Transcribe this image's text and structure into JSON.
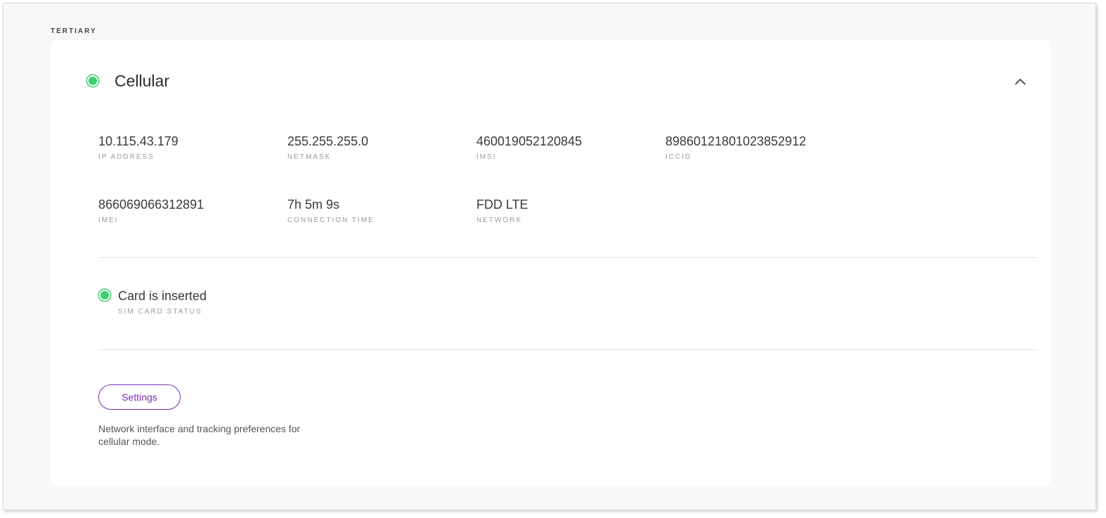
{
  "section": {
    "label": "TERTIARY"
  },
  "interface": {
    "title": "Cellular",
    "status_color": "#3ecf6e",
    "collapse_icon": "chevron-up-icon"
  },
  "fields": {
    "ip_address": {
      "value": "10.115.43.179",
      "label": "IP ADDRESS"
    },
    "netmask": {
      "value": "255.255.255.0",
      "label": "NETMASK"
    },
    "imsi": {
      "value": "460019052120845",
      "label": "IMSI"
    },
    "iccid": {
      "value": "89860121801023852912",
      "label": "ICCID"
    },
    "imei": {
      "value": "866069066312891",
      "label": "IMEI"
    },
    "connection_time": {
      "value": "7h 5m 9s",
      "label": "CONNECTION TIME"
    },
    "network": {
      "value": "FDD LTE",
      "label": "NETWORK"
    }
  },
  "sim": {
    "value": "Card is inserted",
    "label": "SIM CARD STATUS",
    "status_color": "#3ecf6e"
  },
  "settings": {
    "button_label": "Settings",
    "description": "Network interface and tracking preferences for cellular mode.",
    "accent_color": "#7a2fb0"
  }
}
